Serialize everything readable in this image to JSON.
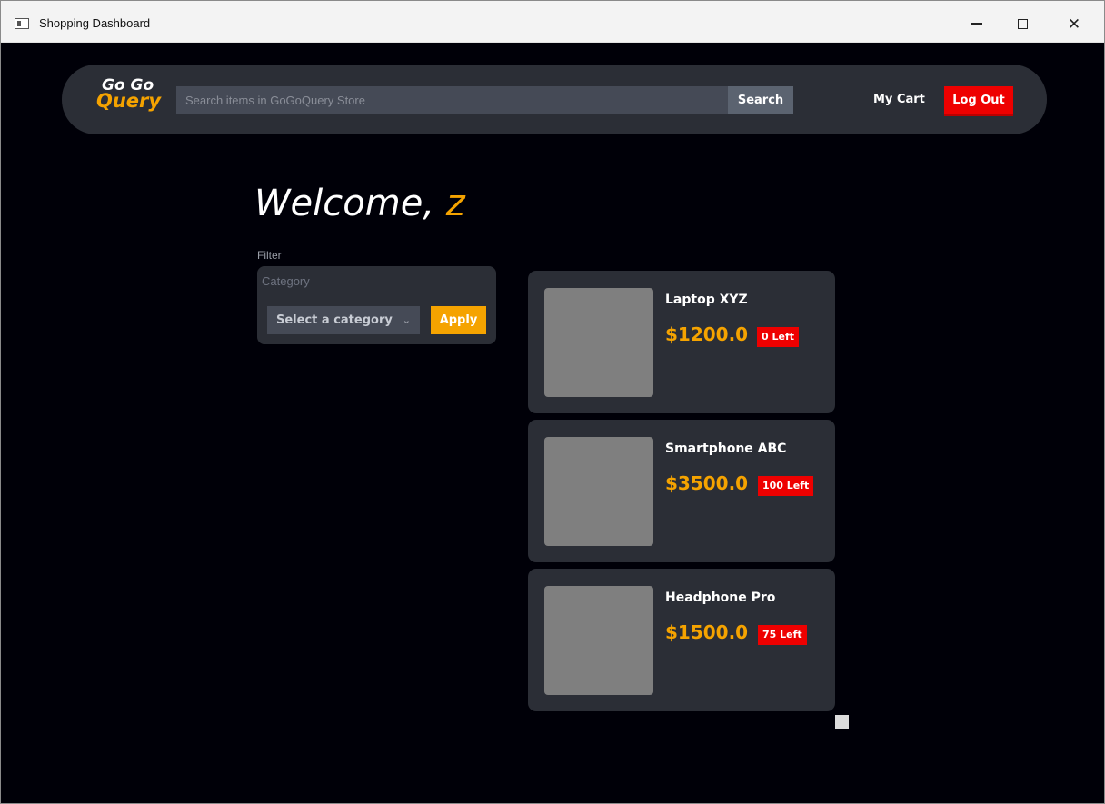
{
  "window": {
    "title": "Shopping Dashboard",
    "controls": {
      "minimize": "",
      "maximize": "",
      "close": "✕"
    }
  },
  "navbar": {
    "logo_top": "Go Go",
    "logo_bottom": "Query",
    "search_placeholder": "Search items in GoGoQuery Store",
    "search_label": "Search",
    "cart_label": "My Cart",
    "logout_label": "Log Out"
  },
  "welcome": {
    "greeting": "Welcome, ",
    "username": "z"
  },
  "filter": {
    "label": "Filter",
    "category_label": "Category",
    "select_value": "Select a category",
    "apply_label": "Apply"
  },
  "products": [
    {
      "name": "Laptop XYZ",
      "price": "$1200.0",
      "stock": "0 Left"
    },
    {
      "name": "Smartphone ABC",
      "price": "$3500.0",
      "stock": "100 Left"
    },
    {
      "name": "Headphone Pro",
      "price": "$1500.0",
      "stock": "75 Left"
    }
  ],
  "colors": {
    "background": "#000008",
    "panel": "#2b2e36",
    "accent": "#f5a300",
    "danger": "#ee0000",
    "input": "#454a56"
  },
  "icons": {
    "app": "window-app-icon",
    "select_chevron": "chevron-down-icon"
  }
}
